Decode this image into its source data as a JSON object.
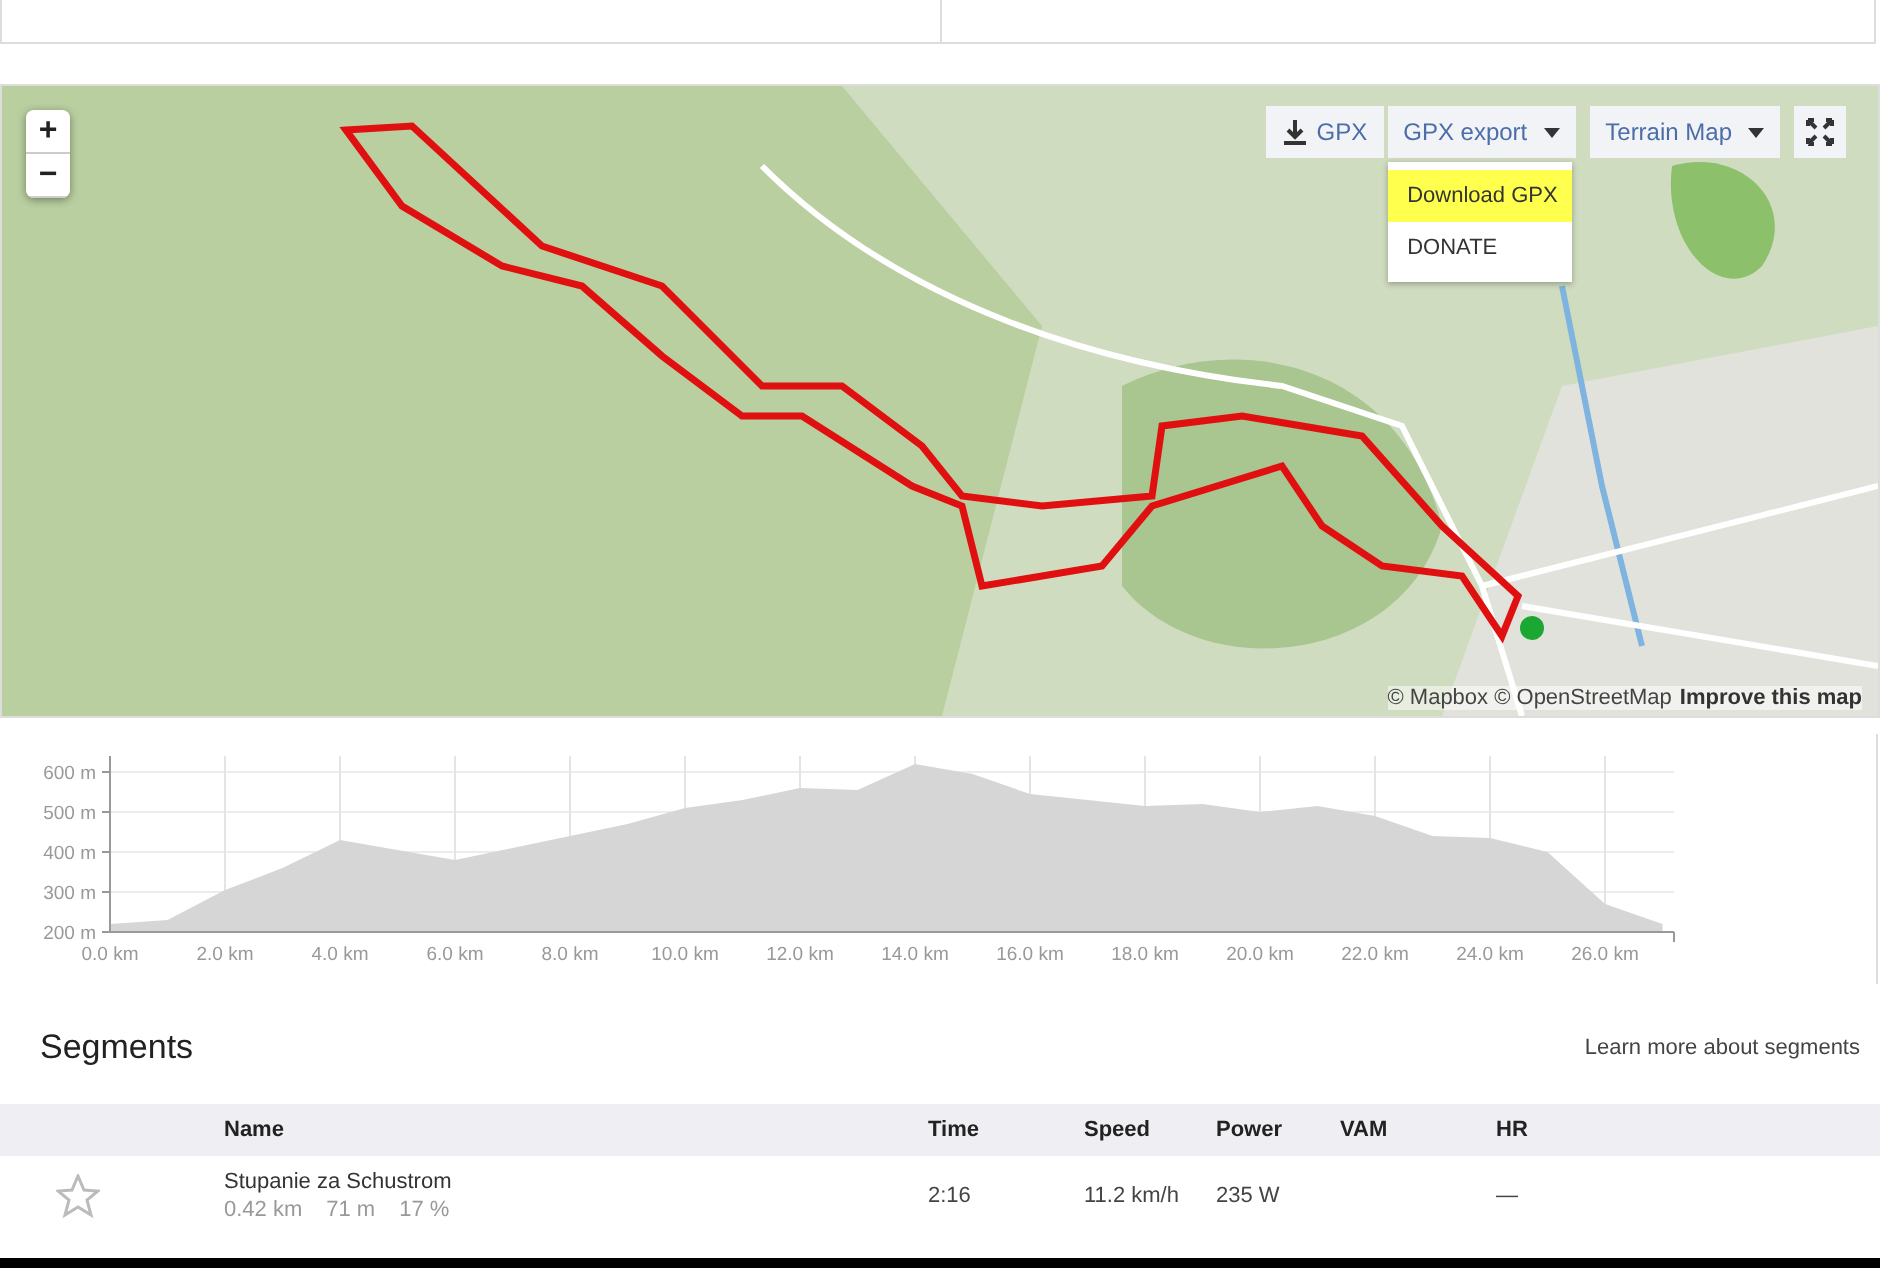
{
  "map": {
    "zoom_buttons": [
      "+",
      "−"
    ],
    "toolbar": {
      "gpx_button": "GPX",
      "export_button": "GPX export",
      "layer_button": "Terrain Map"
    },
    "export_menu": [
      {
        "label": "Download GPX",
        "selected": true
      },
      {
        "label": "DONATE",
        "selected": false
      }
    ],
    "attribution": {
      "text": "© Mapbox © OpenStreetMap",
      "link": "Improve this map"
    }
  },
  "elevation": {
    "chart_data": {
      "type": "area",
      "x": [
        0,
        1,
        2,
        3,
        4,
        5,
        6,
        7,
        8,
        9,
        10,
        11,
        12,
        13,
        14,
        15,
        16,
        17,
        18,
        19,
        20,
        21,
        22,
        23,
        24,
        25,
        26,
        27
      ],
      "grid": true,
      "series": [
        {
          "color": "#d6d6d6",
          "values": [
            220,
            230,
            305,
            360,
            430,
            405,
            380,
            410,
            440,
            470,
            510,
            530,
            560,
            555,
            620,
            595,
            545,
            530,
            515,
            520,
            500,
            515,
            490,
            440,
            435,
            400,
            270,
            220
          ]
        }
      ],
      "xlim": [
        0,
        27.2
      ],
      "ylim": [
        200,
        640
      ],
      "xticks": [
        {
          "value": 0,
          "label": "0.0 km"
        },
        {
          "value": 2,
          "label": "2.0 km"
        },
        {
          "value": 4,
          "label": "4.0 km"
        },
        {
          "value": 6,
          "label": "6.0 km"
        },
        {
          "value": 8,
          "label": "8.0 km"
        },
        {
          "value": 10,
          "label": "10.0 km"
        },
        {
          "value": 12,
          "label": "12.0 km"
        },
        {
          "value": 14,
          "label": "14.0 km"
        },
        {
          "value": 16,
          "label": "16.0 km"
        },
        {
          "value": 18,
          "label": "18.0 km"
        },
        {
          "value": 20,
          "label": "20.0 km"
        },
        {
          "value": 22,
          "label": "22.0 km"
        },
        {
          "value": 24,
          "label": "24.0 km"
        },
        {
          "value": 26,
          "label": "26.0 km"
        }
      ],
      "yticks": [
        {
          "value": 200,
          "label": "200 m"
        },
        {
          "value": 300,
          "label": "300 m"
        },
        {
          "value": 400,
          "label": "400 m"
        },
        {
          "value": 500,
          "label": "500 m"
        },
        {
          "value": 600,
          "label": "600 m"
        }
      ]
    }
  },
  "segments": {
    "title": "Segments",
    "help_link": "Learn more about segments",
    "columns": [
      "Name",
      "Time",
      "Speed",
      "Power",
      "VAM",
      "HR"
    ],
    "rows": [
      {
        "name": "Stupanie za Schustrom",
        "distance": "0.42 km",
        "elevation": "71 m",
        "grade": "17 %",
        "time": "2:16",
        "speed": "11.2 km/h",
        "power": "235 W",
        "hr": "—"
      }
    ]
  }
}
